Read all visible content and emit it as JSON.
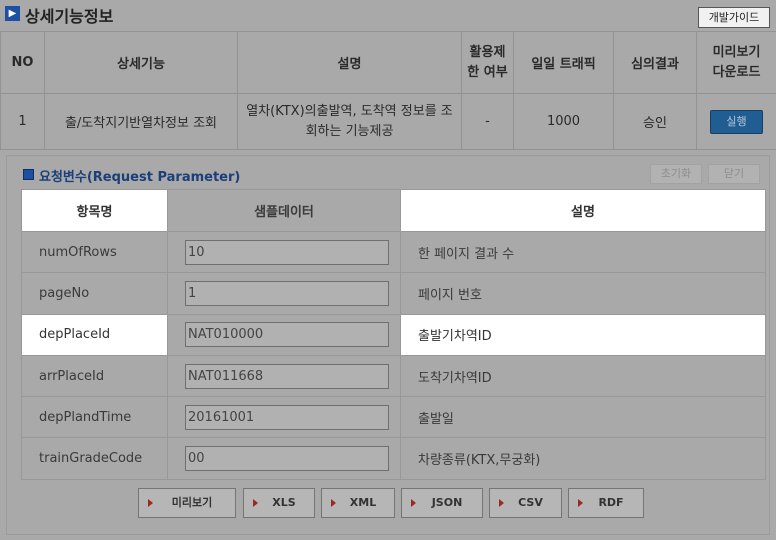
{
  "header": {
    "title": "상세기능정보",
    "dev_guide_label": "개발가이드"
  },
  "function_table": {
    "headers": [
      "NO",
      "상세기능",
      "설명",
      "활용제\n한 여부",
      "일일 트래픽",
      "심의결과",
      "미리보기\n다운로드"
    ],
    "row": {
      "no": "1",
      "name": "출/도착지기반열차정보 조회",
      "description": "열차(KTX)의출발역, 도착역 정보를 조회하는 기능제공",
      "restriction": "-",
      "traffic": "1000",
      "review": "승인",
      "action_label": "실행"
    }
  },
  "request": {
    "title": "요청변수(Request Parameter)",
    "reset_label": "초기화",
    "close_label": "닫기",
    "columns": [
      "항목명",
      "샘플데이터",
      "설명"
    ],
    "rows": [
      {
        "name": "numOfRows",
        "sample": "10",
        "desc": "한 페이지 결과 수"
      },
      {
        "name": "pageNo",
        "sample": "1",
        "desc": "페이지 번호"
      },
      {
        "name": "depPlaceId",
        "sample": "NAT010000",
        "desc": "출발기차역ID"
      },
      {
        "name": "arrPlaceId",
        "sample": "NAT011668",
        "desc": "도착기차역ID"
      },
      {
        "name": "depPlandTime",
        "sample": "20161001",
        "desc": "출발일"
      },
      {
        "name": "trainGradeCode",
        "sample": "00",
        "desc": "차량종류(KTX,무궁화)"
      }
    ]
  },
  "buttons": {
    "preview": "미리보기",
    "xls": "XLS",
    "xml": "XML",
    "json": "JSON",
    "csv": "CSV",
    "rdf": "RDF"
  },
  "colors": {
    "accent_blue": "#1e4fa0",
    "run_button": "#1f5d92",
    "format_arrow": "#9b2a1e",
    "highlight": "#ffffff"
  },
  "icons": {
    "title": "chevron-right-icon",
    "request": "square-bullet-icon",
    "format_buttons": "triangle-right-icon"
  }
}
